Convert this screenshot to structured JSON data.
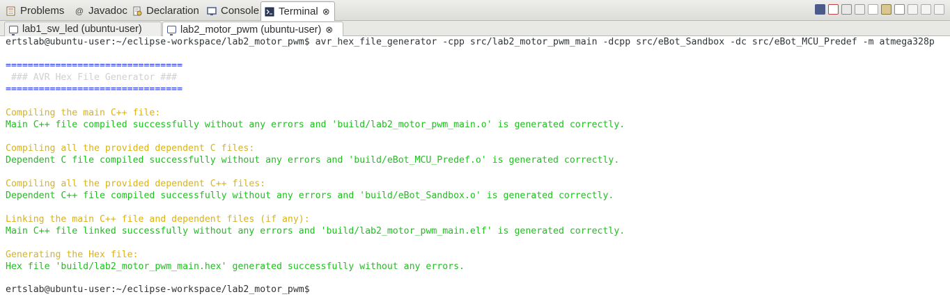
{
  "view_tabs": [
    {
      "label": "Problems",
      "icon": "problems-icon",
      "active": false
    },
    {
      "label": "Javadoc",
      "icon": "at-icon",
      "active": false
    },
    {
      "label": "Declaration",
      "icon": "declaration-icon",
      "active": false
    },
    {
      "label": "Console",
      "icon": "console-icon",
      "active": false
    },
    {
      "label": "Terminal",
      "icon": "terminal-icon",
      "active": true,
      "close": "⊗"
    }
  ],
  "session_tabs": [
    {
      "label": "lab1_sw_led (ubuntu-user)",
      "active": false
    },
    {
      "label": "lab2_motor_pwm (ubuntu-user)",
      "active": true,
      "close": "⊗"
    }
  ],
  "terminal": {
    "lines": [
      {
        "text": "ertslab@ubuntu-user:~/eclipse-workspace/lab2_motor_pwm$ avr_hex_file_generator -cpp src/lab2_motor_pwm_main -dcpp src/eBot_Sandbox -dc src/eBot_MCU_Predef -m atmega328p",
        "color": "default"
      },
      {
        "text": "================================",
        "color": "blue"
      },
      {
        "text": " ### AVR Hex File Generator ###",
        "color": "gray"
      },
      {
        "text": "================================",
        "color": "blue"
      },
      {
        "text": "Compiling the main C++ file:",
        "color": "yellow"
      },
      {
        "text": "Main C++ file compiled successfully without any errors and 'build/lab2_motor_pwm_main.o' is generated correctly.",
        "color": "green"
      },
      {
        "text": "Compiling all the provided dependent C files:",
        "color": "yellow"
      },
      {
        "text": "Dependent C file compiled successfully without any errors and 'build/eBot_MCU_Predef.o' is generated correctly.",
        "color": "green"
      },
      {
        "text": "Compiling all the provided dependent C++ files:",
        "color": "yellow"
      },
      {
        "text": "Dependent C++ file compiled successfully without any errors and 'build/eBot_Sandbox.o' is generated correctly.",
        "color": "green"
      },
      {
        "text": "Linking the main C++ file and dependent files (if any):",
        "color": "yellow"
      },
      {
        "text": "Main C++ file linked successfully without any errors and 'build/lab2_motor_pwm_main.elf' is generated correctly.",
        "color": "green"
      },
      {
        "text": "Generating the Hex file:",
        "color": "yellow"
      },
      {
        "text": "Hex file 'build/lab2_motor_pwm_main.hex' generated successfully without any errors.",
        "color": "green"
      },
      {
        "text": "ertslab@ubuntu-user:~/eclipse-workspace/lab2_motor_pwm$",
        "color": "default"
      }
    ]
  },
  "toolbar_icons": [
    "new-terminal-icon",
    "disconnect-icon",
    "scroll-lock-icon",
    "clear-icon",
    "copy-icon",
    "paste-icon",
    "select-all-icon",
    "view-menu-icon",
    "minimize-icon",
    "maximize-icon"
  ],
  "colors": {
    "prompt": "#2e3436",
    "separator": "#1a2cf0",
    "banner": "#d0d0d0",
    "step": "#d9b318",
    "success": "#1fbf1f"
  }
}
